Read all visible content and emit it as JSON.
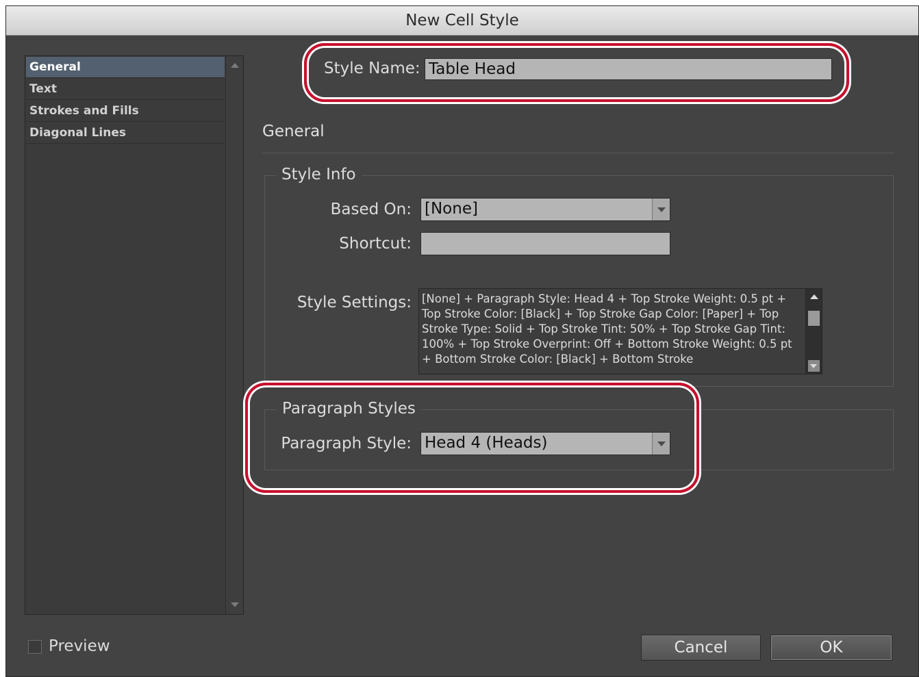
{
  "window": {
    "title": "New Cell Style"
  },
  "sidebar": {
    "items": [
      {
        "label": "General",
        "selected": true
      },
      {
        "label": "Text",
        "selected": false
      },
      {
        "label": "Strokes and Fills",
        "selected": false
      },
      {
        "label": "Diagonal Lines",
        "selected": false
      }
    ]
  },
  "style_name": {
    "label": "Style Name:",
    "value": "Table Head"
  },
  "section": {
    "title": "General"
  },
  "style_info": {
    "title": "Style Info",
    "based_on_label": "Based On:",
    "based_on_value": "[None]",
    "shortcut_label": "Shortcut:",
    "shortcut_value": "",
    "settings_label": "Style Settings:",
    "settings_text": "[None] + Paragraph Style: Head 4 + Top Stroke Weight: 0.5 pt + Top Stroke Color: [Black] + Top Stroke Gap Color: [Paper] + Top Stroke Type: Solid + Top Stroke Tint: 50% + Top Stroke Gap Tint: 100% + Top Stroke Overprint: Off + Bottom Stroke Weight: 0.5 pt + Bottom Stroke Color: [Black] + Bottom Stroke"
  },
  "paragraph_styles": {
    "title": "Paragraph Styles",
    "label": "Paragraph Style:",
    "value": "Head 4 (Heads)"
  },
  "footer": {
    "preview_label": "Preview",
    "preview_checked": false,
    "cancel_label": "Cancel",
    "ok_label": "OK"
  },
  "colors": {
    "panel_bg": "#434343",
    "selection": "#52606f",
    "highlight_ring": "#c8102e"
  }
}
